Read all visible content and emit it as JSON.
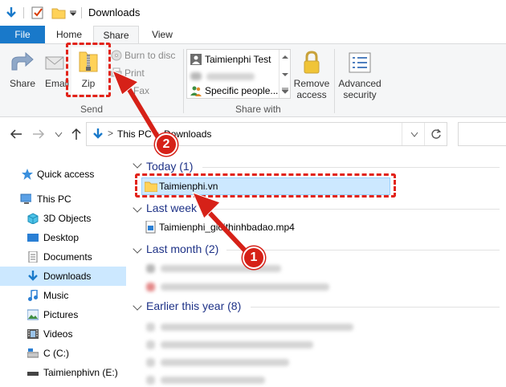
{
  "window": {
    "title": "Downloads"
  },
  "ribbon_tabs": [
    "File",
    "Home",
    "Share",
    "View"
  ],
  "ribbon": {
    "share_label": "Share",
    "email_label": "Email",
    "zip_label": "Zip",
    "burn_label": "Burn to disc",
    "print_label": "Print",
    "fax_label": "Fax",
    "send_group": "Send",
    "share_with_items": [
      "Taimienphi Test",
      "Specific people..."
    ],
    "share_with_group": "Share with",
    "remove_access_label": "Remove access",
    "advanced_security_label": "Advanced security"
  },
  "address": {
    "path": [
      "This PC",
      "Downloads"
    ],
    "separator": ">"
  },
  "nav_pane": {
    "items": [
      {
        "label": "Quick access",
        "icon": "star-icon"
      },
      {
        "label": "This PC",
        "icon": "pc-icon"
      },
      {
        "label": "3D Objects",
        "icon": "cube-icon"
      },
      {
        "label": "Desktop",
        "icon": "desktop-icon"
      },
      {
        "label": "Documents",
        "icon": "documents-icon"
      },
      {
        "label": "Downloads",
        "icon": "download-arrow-icon",
        "selected": true
      },
      {
        "label": "Music",
        "icon": "music-icon"
      },
      {
        "label": "Pictures",
        "icon": "pictures-icon"
      },
      {
        "label": "Videos",
        "icon": "videos-icon"
      },
      {
        "label": "C (C:)",
        "icon": "drive-icon"
      },
      {
        "label": "Taimienphivn (E:)",
        "icon": "usb-drive-icon"
      }
    ]
  },
  "content": {
    "groups": [
      {
        "header": "Today (1)",
        "files": [
          "Taimienphi.vn"
        ]
      },
      {
        "header": "Last week",
        "files": [
          "Taimienphi_gioithinhbadao.mp4"
        ]
      },
      {
        "header": "Last month (2)",
        "files": []
      },
      {
        "header": "Earlier this year (8)",
        "files": []
      }
    ]
  },
  "annotations": {
    "badge1": "1",
    "badge2": "2"
  },
  "colors": {
    "file_tab": "#1979ca",
    "selection": "#cce8ff",
    "highlight_red": "#e2231a",
    "group_header": "#1e3287"
  }
}
